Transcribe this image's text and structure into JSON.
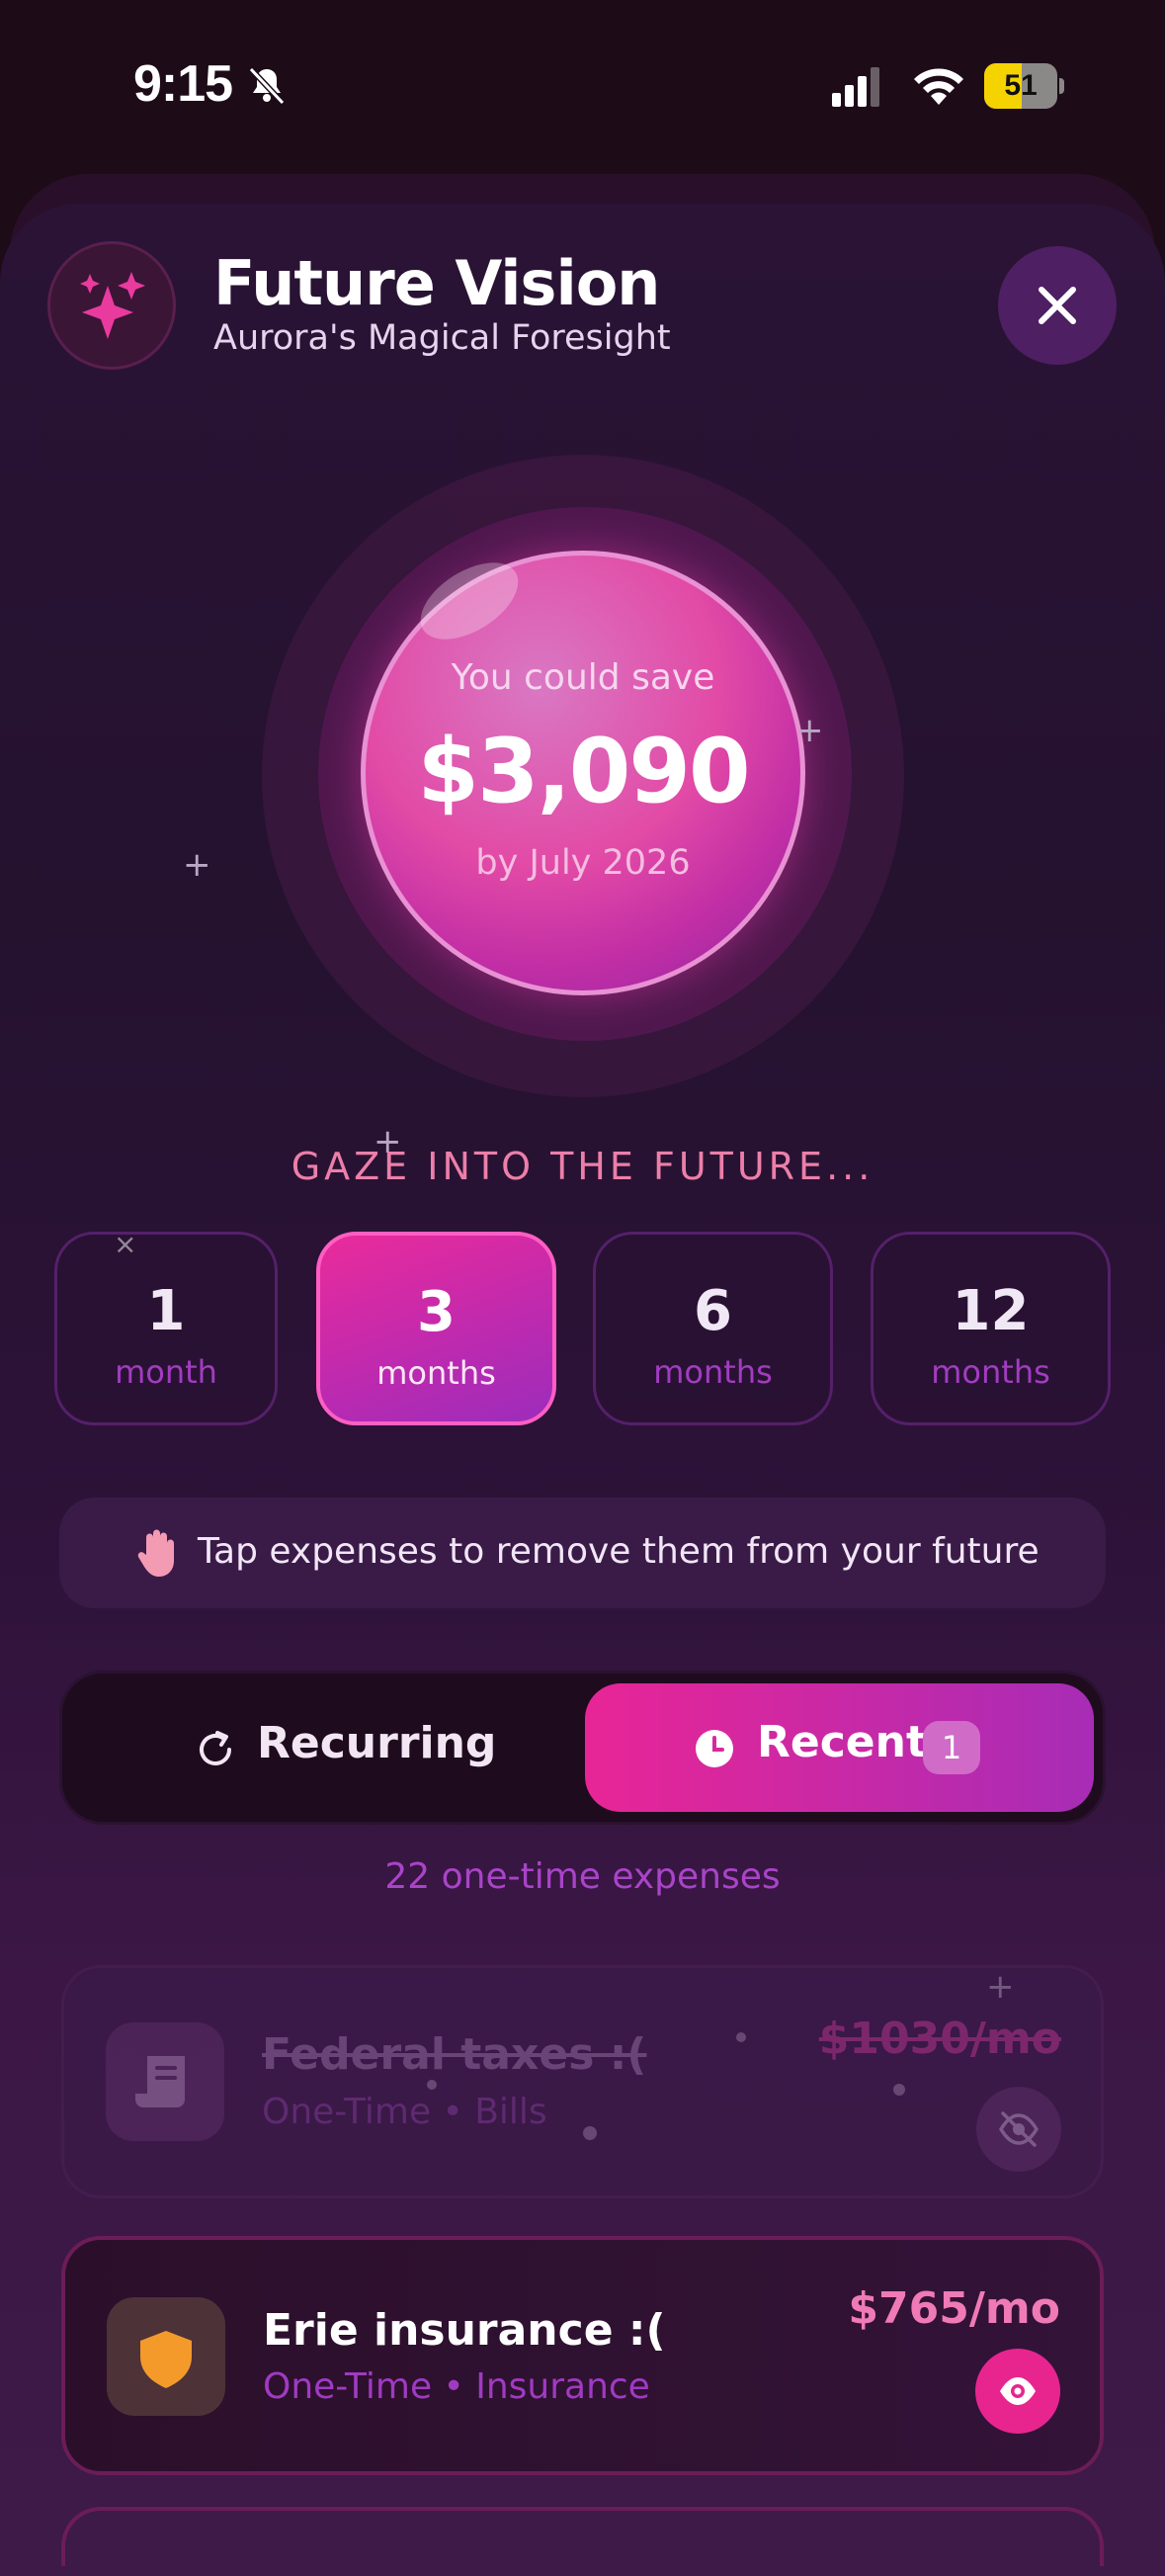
{
  "status_bar": {
    "time": "9:15",
    "battery_level": "51"
  },
  "header": {
    "title": "Future Vision",
    "subtitle": "Aurora's Magical Foresight"
  },
  "savings_orb": {
    "label": "You could save",
    "amount": "$3,090",
    "date_text": "by July 2026"
  },
  "period_section": {
    "heading": "GAZE INTO THE FUTURE...",
    "options": [
      {
        "number": "1",
        "unit": "month",
        "selected": false
      },
      {
        "number": "3",
        "unit": "months",
        "selected": true
      },
      {
        "number": "6",
        "unit": "months",
        "selected": false
      },
      {
        "number": "12",
        "unit": "months",
        "selected": false
      }
    ]
  },
  "tip": {
    "text": "Tap expenses to remove them from your future"
  },
  "toggle": {
    "recurring_label": "Recurring",
    "recent_label": "Recent",
    "recent_badge": "1",
    "active": "recent"
  },
  "expense_count": "22 one-time expenses",
  "expenses": [
    {
      "name": "Federal taxes :(",
      "meta": "One-Time • Bills",
      "amount": "$1030/mo",
      "icon": "receipt-icon",
      "removed": true
    },
    {
      "name": "Erie insurance :(",
      "meta": "One-Time • Insurance",
      "amount": "$765/mo",
      "icon": "shield-icon",
      "removed": false
    }
  ],
  "colors": {
    "accent_pink": "#e82596",
    "accent_purple": "#a72cb6",
    "amount_pink": "#f07ab6",
    "meta_purple": "#a03ac2",
    "shield_orange": "#f39a2b"
  }
}
